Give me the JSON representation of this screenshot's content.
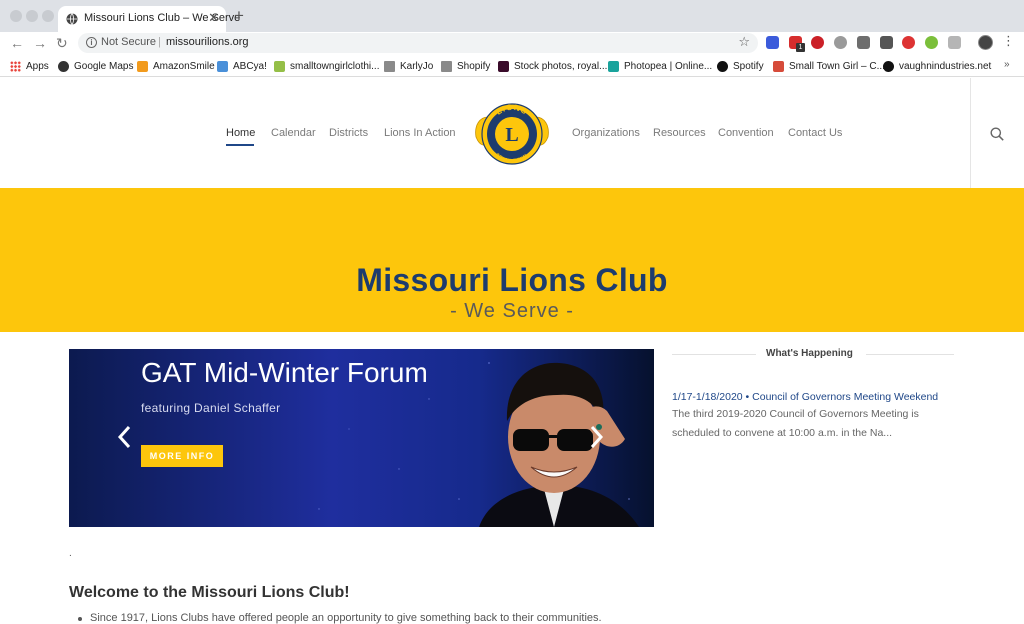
{
  "browser": {
    "tab_title": "Missouri Lions Club – We Serve",
    "security_label": "Not Secure",
    "url": "missourilions.org",
    "bookmarks": [
      {
        "label": "Apps",
        "icon": "apps-grid-icon",
        "color": "#e8453c"
      },
      {
        "label": "Google Maps",
        "icon": "globe-icon",
        "color": "#333333"
      },
      {
        "label": "AmazonSmile",
        "icon": "amazon-icon",
        "color": "#f29b1d"
      },
      {
        "label": "ABCya!",
        "icon": "abcya-icon",
        "color": "#4a90d9"
      },
      {
        "label": "smalltowngirlclothi...",
        "icon": "shopify-icon",
        "color": "#95bf47"
      },
      {
        "label": "KarlyJo",
        "icon": "folder-icon",
        "color": "#8a8a8a"
      },
      {
        "label": "Shopify",
        "icon": "folder-icon",
        "color": "#8a8a8a"
      },
      {
        "label": "Stock photos, royal...",
        "icon": "adobe-stock-icon",
        "color": "#3a0b2a"
      },
      {
        "label": "Photopea | Online...",
        "icon": "photopea-icon",
        "color": "#1aa39c"
      },
      {
        "label": "Spotify",
        "icon": "spotify-icon",
        "color": "#111111"
      },
      {
        "label": "Small Town Girl – C...",
        "icon": "store-icon",
        "color": "#d64b3a"
      },
      {
        "label": "vaughnindustries.net",
        "icon": "vaughn-icon",
        "color": "#111111"
      }
    ],
    "extension_badge": "1"
  },
  "nav": {
    "left": [
      "Home",
      "Calendar",
      "Districts",
      "Lions In Action"
    ],
    "right": [
      "Organizations",
      "Resources",
      "Convention",
      "Contact Us"
    ],
    "active": "Home"
  },
  "hero": {
    "title": "Missouri Lions Club",
    "subtitle": "- We Serve -"
  },
  "slider": {
    "title": "GAT Mid-Winter Forum",
    "subtitle": "featuring Daniel Schaffer",
    "button": "MORE INFO"
  },
  "whats_happening": {
    "heading": "What's Happening",
    "event_link": "1/17-1/18/2020 • Council of Governors Meeting Weekend",
    "event_excerpt": "The third 2019-2020 Council of Governors Meeting is scheduled to convene at 10:00 a.m. in the Na..."
  },
  "welcome": {
    "stray_text": ".",
    "heading": "Welcome to the Missouri Lions Club!",
    "bullets": [
      "Since 1917, Lions Clubs have offered people an opportunity to give something back to their communities."
    ]
  },
  "colors": {
    "brand_blue": "#1d3c6e",
    "brand_yellow": "#fdc60c",
    "link_blue": "#1f4788"
  }
}
